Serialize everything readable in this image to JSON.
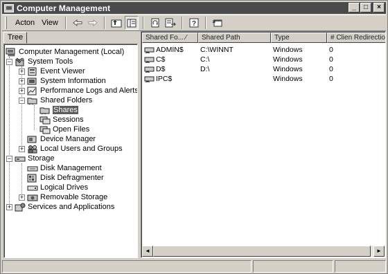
{
  "window": {
    "title": "Computer Management"
  },
  "title_buttons": {
    "minimize": "_",
    "maximize": "□",
    "close": "×"
  },
  "menu": {
    "action": "Acton",
    "view": "View"
  },
  "toolbar_icons": [
    "back-arrow-icon",
    "forward-arrow-icon",
    "up-folder-icon",
    "show-hide-tree-icon",
    "refresh-icon",
    "export-list-icon",
    "help-icon",
    "new-window-icon"
  ],
  "tab": {
    "label": "Tree"
  },
  "tree": [
    {
      "label": "Computer Management (Local)",
      "icon": "computer-icon",
      "expander": ""
    },
    {
      "label": "System Tools",
      "icon": "tools-icon",
      "expander": "−"
    },
    {
      "label": "Event Viewer",
      "icon": "event-viewer-icon",
      "expander": "+"
    },
    {
      "label": "System Information",
      "icon": "system-info-icon",
      "expander": "+"
    },
    {
      "label": "Performance Logs and Alerts",
      "icon": "perf-logs-icon",
      "expander": "+"
    },
    {
      "label": "Shared Folders",
      "icon": "shared-folder-icon",
      "expander": "−"
    },
    {
      "label": "Shares",
      "icon": "shares-icon",
      "expander": ""
    },
    {
      "label": "Sessions",
      "icon": "sessions-icon",
      "expander": ""
    },
    {
      "label": "Open Files",
      "icon": "open-files-icon",
      "expander": ""
    },
    {
      "label": "Device Manager",
      "icon": "device-manager-icon",
      "expander": ""
    },
    {
      "label": "Local Users and Groups",
      "icon": "users-icon",
      "expander": "+"
    },
    {
      "label": "Storage",
      "icon": "storage-icon",
      "expander": "−"
    },
    {
      "label": "Disk Management",
      "icon": "disk-mgmt-icon",
      "expander": ""
    },
    {
      "label": "Disk Defragmenter",
      "icon": "defrag-icon",
      "expander": ""
    },
    {
      "label": "Logical Drives",
      "icon": "logical-drives-icon",
      "expander": ""
    },
    {
      "label": "Removable Storage",
      "icon": "removable-storage-icon",
      "expander": "+"
    },
    {
      "label": "Services and Applications",
      "icon": "services-icon",
      "expander": "+"
    }
  ],
  "selected_tree_item": "Shares",
  "list": {
    "columns": [
      "Shared Fo... ⁄",
      "Shared Path",
      "Type",
      "# Clien Redirection"
    ],
    "rows": [
      {
        "name": "ADMIN$",
        "path": "C:\\WINNT",
        "type": "Windows",
        "clients": "0"
      },
      {
        "name": "C$",
        "path": "C:\\",
        "type": "Windows",
        "clients": "0"
      },
      {
        "name": "D$",
        "path": "D:\\",
        "type": "Windows",
        "clients": "0"
      },
      {
        "name": "IPC$",
        "path": "",
        "type": "Windows",
        "clients": "0"
      }
    ]
  },
  "scrollbar": {
    "left": "◄",
    "right": "►"
  }
}
